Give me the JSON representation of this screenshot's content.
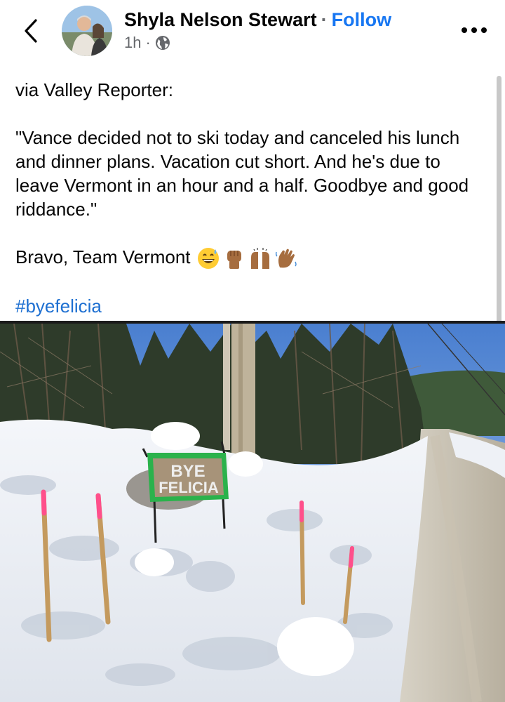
{
  "header": {
    "author_name": "Shyla Nelson Stewart",
    "separator": "·",
    "follow_label": "Follow",
    "timestamp": "1h",
    "meta_separator": "·",
    "audience_icon": "globe-icon",
    "back_icon": "chevron-left-icon",
    "more_icon": "more-horizontal-icon"
  },
  "post": {
    "line_source": "via Valley Reporter:",
    "quote": "\"Vance decided not to ski today and canceled his lunch and dinner plans. Vacation cut short. And he's due to leave Vermont in an hour and a half. Goodbye and good riddance.\"",
    "bravo_text": "Bravo, Team Vermont",
    "emojis": [
      "grinning-sweat-emoji",
      "raised-fist-emoji",
      "raising-hands-emoji",
      "waving-hand-emoji"
    ],
    "hashtag": "#byefelicia"
  },
  "photo": {
    "sign_line1": "BYE",
    "sign_line2": "FELICIA",
    "sign_color": "#2bb24c"
  },
  "colors": {
    "link": "#1877f2",
    "hashtag": "#1d6fd1",
    "secondary_text": "#65676b"
  }
}
